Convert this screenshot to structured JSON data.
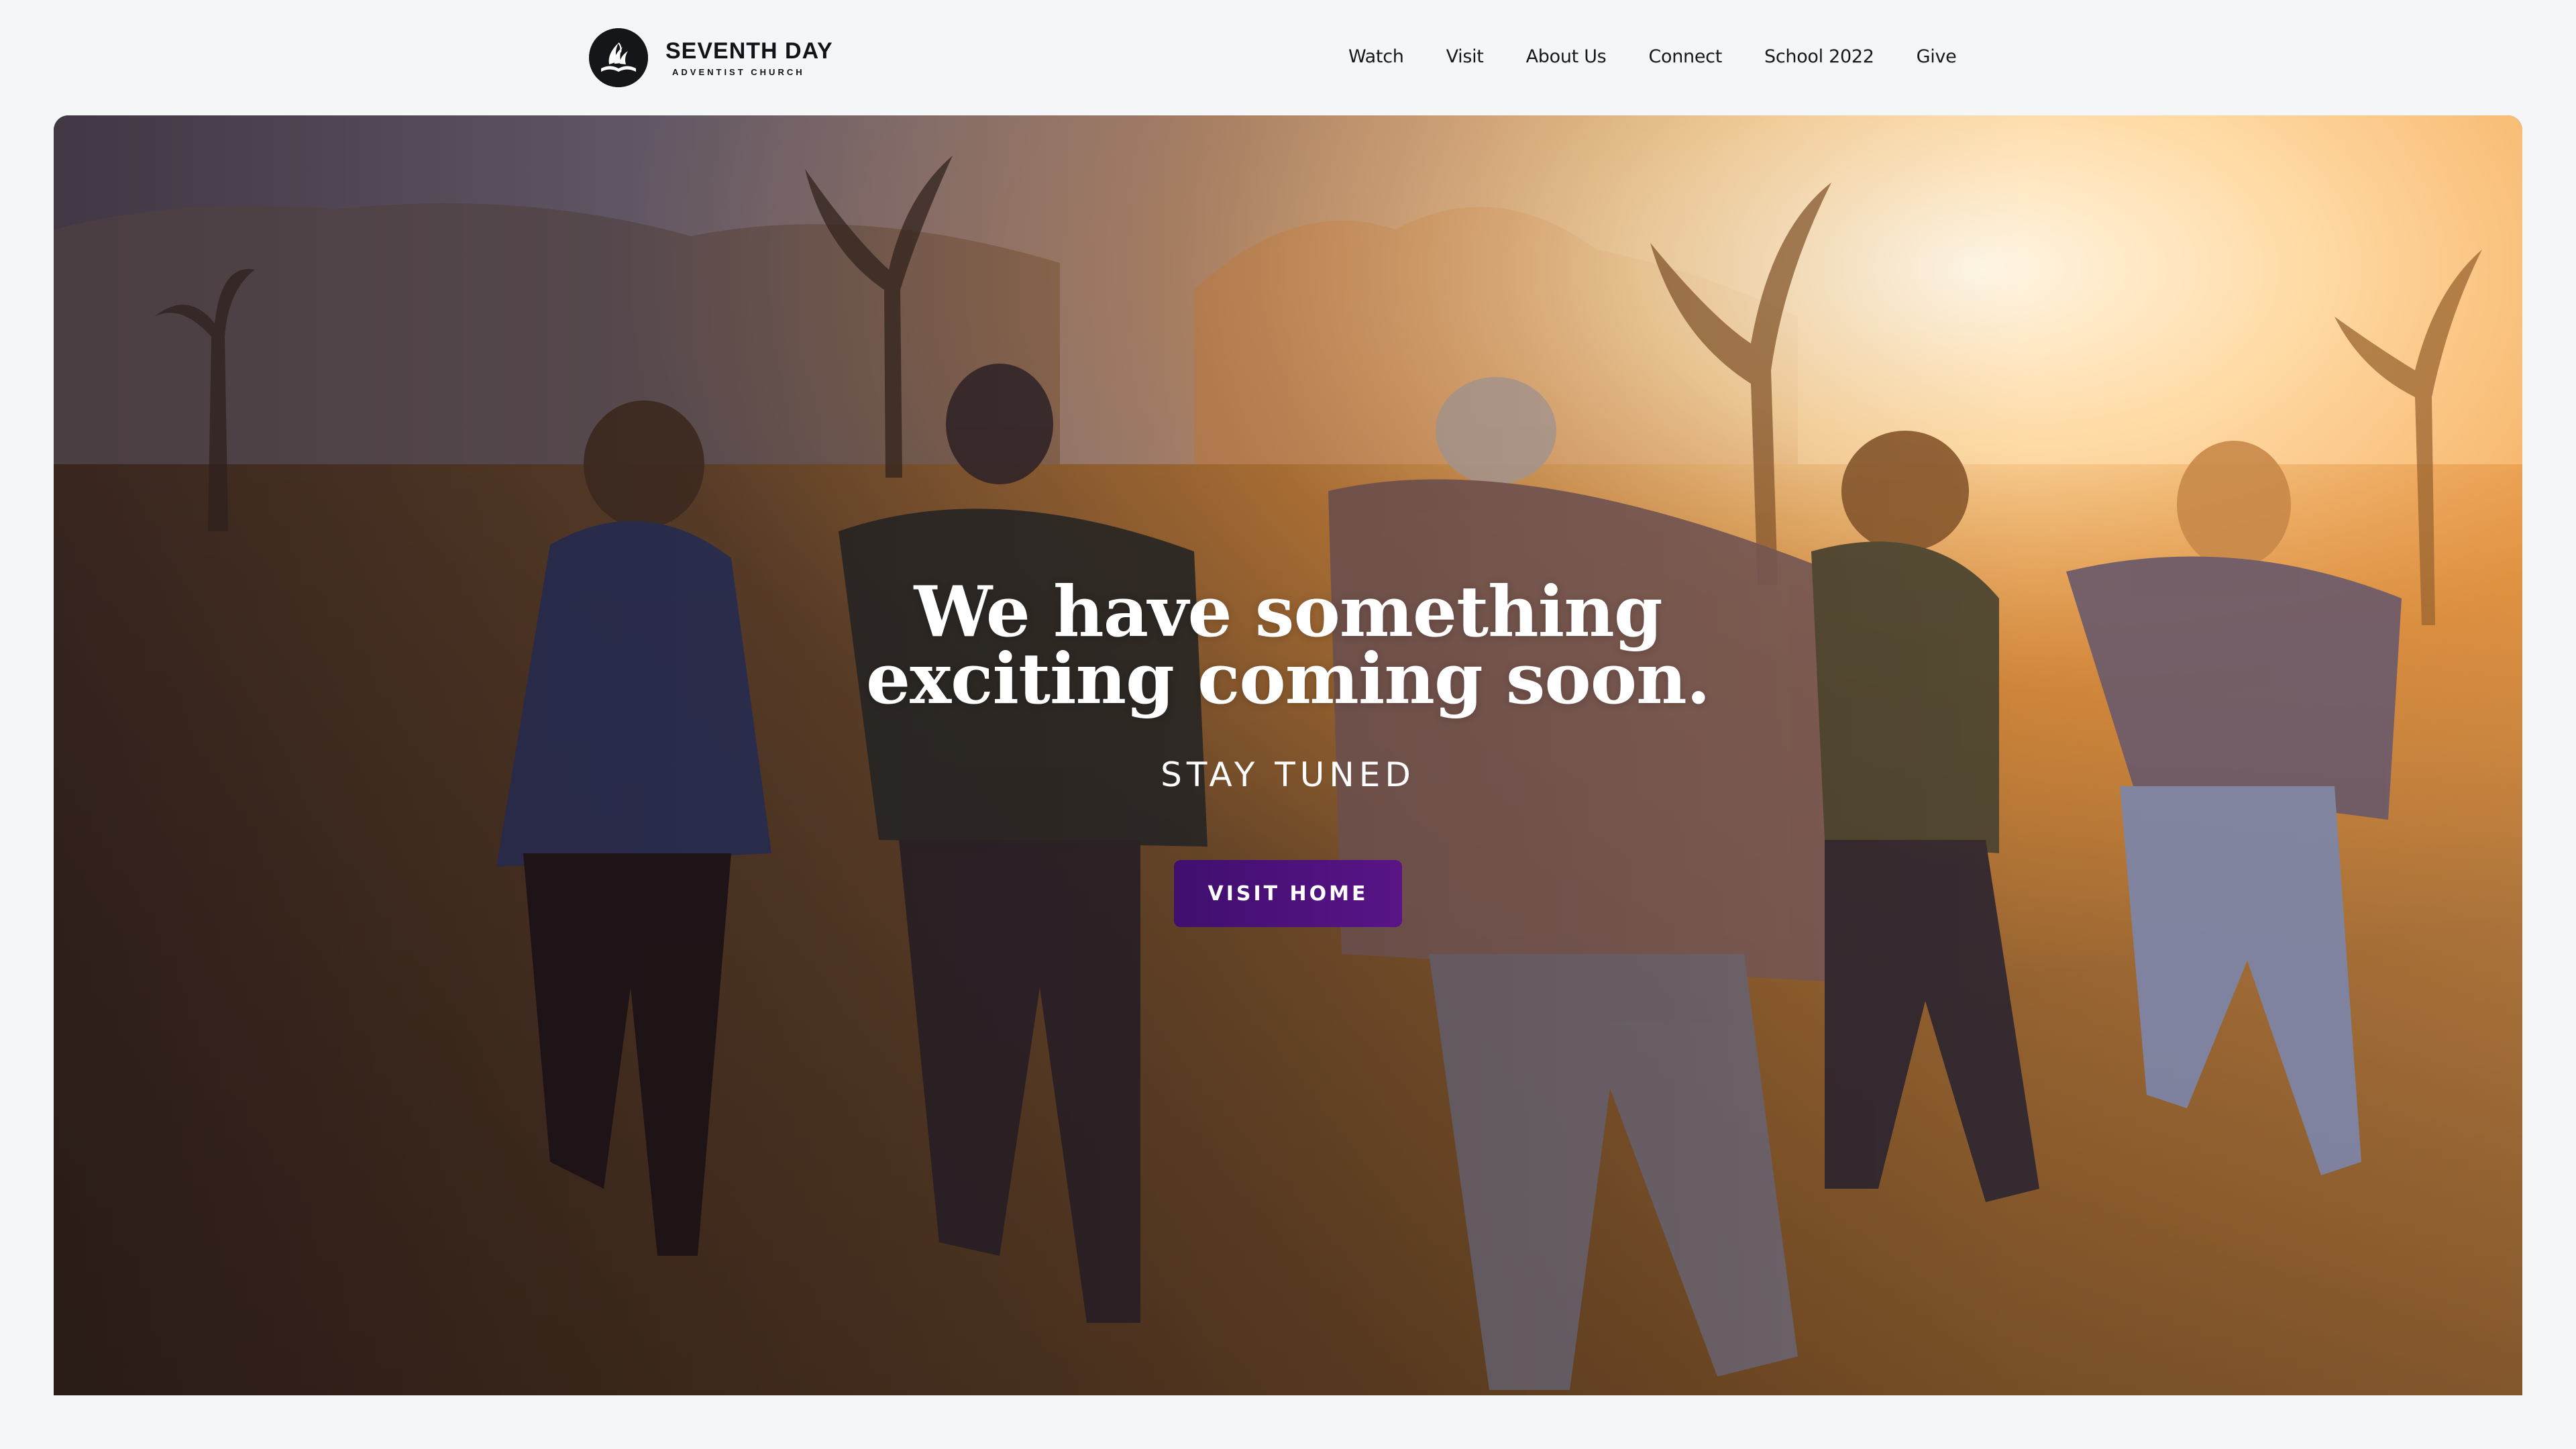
{
  "brand": {
    "title": "SEVENTH DAY",
    "subtitle": "ADVENTIST CHURCH",
    "logo_icon": "adventist-flame-bible-icon"
  },
  "nav": {
    "items": [
      {
        "label": "Watch"
      },
      {
        "label": "Visit"
      },
      {
        "label": "About Us"
      },
      {
        "label": "Connect"
      },
      {
        "label": "School 2022"
      },
      {
        "label": "Give"
      }
    ]
  },
  "hero": {
    "headline_line1": "We have something",
    "headline_line2": "exciting coming soon.",
    "subheadline": "STAY TUNED",
    "cta_label": "VISIT HOME"
  },
  "colors": {
    "page_background": "#f4f6f8",
    "cta_background": "#4a1179",
    "text_dark": "#15171c",
    "text_light": "#ffffff"
  }
}
